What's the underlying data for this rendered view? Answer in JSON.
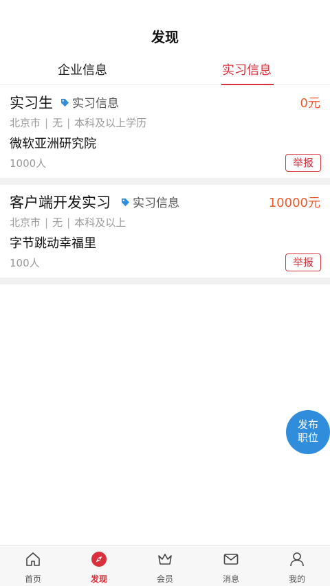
{
  "header": {
    "title": "发现"
  },
  "tabs": [
    {
      "label": "企业信息",
      "active": false
    },
    {
      "label": "实习信息",
      "active": true
    }
  ],
  "jobs": [
    {
      "title": "实习生",
      "tag": "实习信息",
      "salary": "0元",
      "meta": {
        "city": "北京市",
        "experience": "无",
        "education": "本科及以上学历"
      },
      "company": "微软亚洲研究院",
      "size": "1000人",
      "report_label": "举报"
    },
    {
      "title": "客户端开发实习",
      "tag": "实习信息",
      "salary": "10000元",
      "meta": {
        "city": "北京市",
        "experience": "无",
        "education": "本科及以上"
      },
      "company": "字节跳动幸福里",
      "size": "100人",
      "report_label": "举报"
    }
  ],
  "fab": {
    "line1": "发布",
    "line2": "职位"
  },
  "bottom_nav": [
    {
      "label": "首页",
      "icon": "home-icon",
      "active": false
    },
    {
      "label": "发现",
      "icon": "compass-icon",
      "active": true
    },
    {
      "label": "会员",
      "icon": "crown-icon",
      "active": false
    },
    {
      "label": "消息",
      "icon": "mail-icon",
      "active": false
    },
    {
      "label": "我的",
      "icon": "user-icon",
      "active": false
    }
  ],
  "colors": {
    "accent": "#d9303b",
    "salary": "#ef5a2b",
    "fab": "#2f8ddb",
    "tag_icon": "#2f8ddb"
  }
}
